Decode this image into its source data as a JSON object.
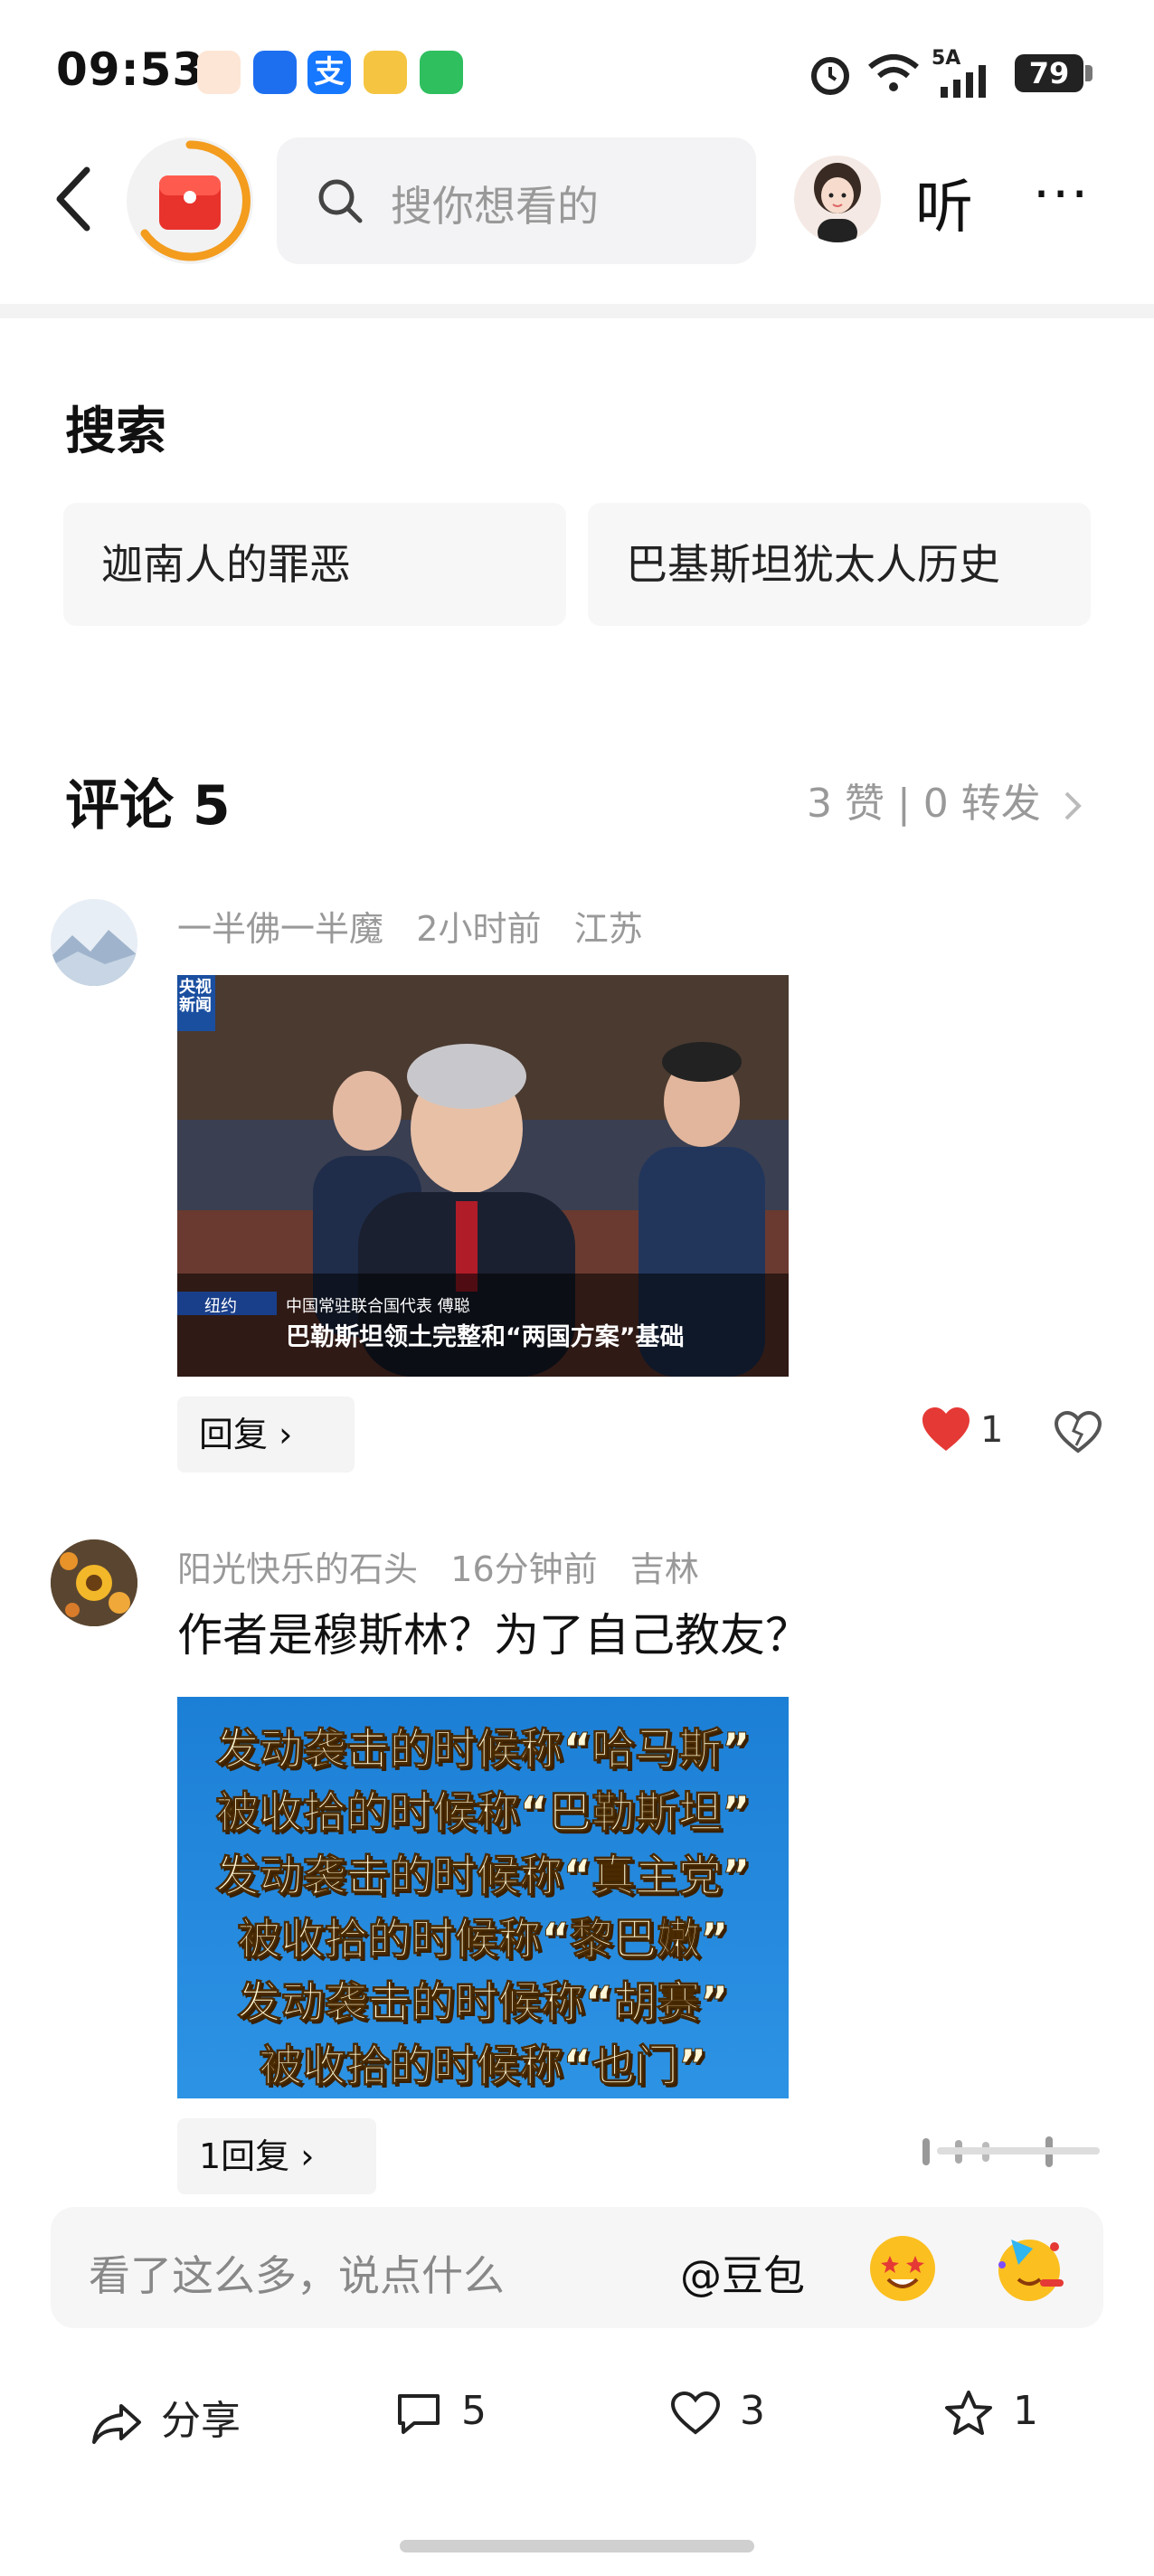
{
  "status_bar": {
    "time": "09:53",
    "network": "5A",
    "battery": "79"
  },
  "header": {
    "search_placeholder": "搜你想看的",
    "listen_label": "听",
    "more_label": "···"
  },
  "search_section": {
    "title": "搜索",
    "tags": [
      "迦南人的罪恶",
      "巴基斯坦犹太人历史"
    ]
  },
  "comments": {
    "title": "评论 5",
    "stats": "3 赞 | 0 转发",
    "items": [
      {
        "username": "一半佛一半魔",
        "time": "2小时前",
        "location": "江苏",
        "image": {
          "logo_line1": "央视",
          "logo_line2": "新闻",
          "caption_location": "纽约",
          "caption_small": "中国常驻联合国代表 傅聪",
          "caption_main": "巴勒斯坦领土完整和“两国方案”基础"
        },
        "reply_label": "回复",
        "like_count": "1"
      },
      {
        "username": "阳光快乐的石头",
        "time": "16分钟前",
        "location": "吉林",
        "text": "作者是穆斯林？为了自己教友？",
        "image_lines": [
          "发动袭击的时候称“哈马斯”",
          "被收拾的时候称“巴勒斯坦”",
          "发动袭击的时候称“真主党”",
          "被收拾的时候称“黎巴嫩”",
          "发动袭击的时候称“胡赛”",
          "被收拾的时候称“也门”"
        ],
        "reply_label": "1回复"
      }
    ]
  },
  "input_bar": {
    "placeholder": "看了这么多，说点什么",
    "mention": "@豆包"
  },
  "bottom_actions": {
    "share": "分享",
    "comments": "5",
    "likes": "3",
    "favorites": "1"
  }
}
